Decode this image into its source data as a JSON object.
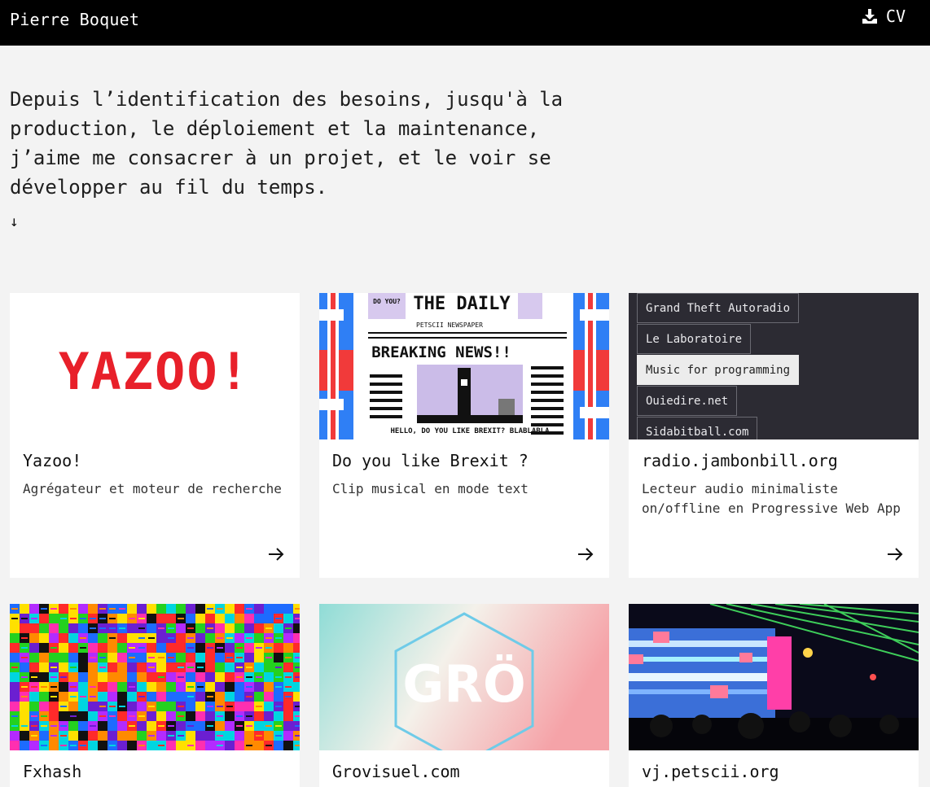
{
  "header": {
    "name": "Pierre Boquet",
    "cv_label": "CV"
  },
  "intro": {
    "text": "Depuis l’identification des besoins, jusqu'à la production, le déploiement et la maintenance, j’aime me consacrer à un projet, et le voir se développer au fil du temps.",
    "arrow": "↓"
  },
  "projects": [
    {
      "title": "Yazoo!",
      "description": "Agrégateur et moteur de recherche",
      "logo_text": "YAZOO!"
    },
    {
      "title": "Do you like Brexit ?",
      "description": "Clip musical en mode text",
      "thumb_texts": [
        "DO YOU?",
        "THE DAILY",
        "PETSCII NEWSPAPER",
        "BREAKING NEWS!!",
        "HELLO, DO YOU LIKE BREXIT? BLABLABLA"
      ]
    },
    {
      "title": "radio.jambonbill.org",
      "description": "Lecteur audio minimaliste on/offline en Progressive Web App",
      "stations": [
        "Grand Theft Autoradio",
        "Le Laboratoire",
        "Music for programming",
        "Ouiedire.net",
        "Sidabitball.com"
      ],
      "active_station": "Music for programming"
    },
    {
      "title": "Fxhash",
      "description": ""
    },
    {
      "title": "Grovisuel.com",
      "description": "",
      "logo_text": "GRÖ"
    },
    {
      "title": "vj.petscii.org",
      "description": ""
    }
  ],
  "colors": {
    "header_bg": "#000000",
    "page_bg": "#f3f3f3",
    "card_bg": "#ffffff",
    "yazoo_red": "#e8202a",
    "radio_bg": "#2c2b33"
  },
  "icons": {
    "cv": "download-icon",
    "card_link": "arrow-right-icon"
  }
}
